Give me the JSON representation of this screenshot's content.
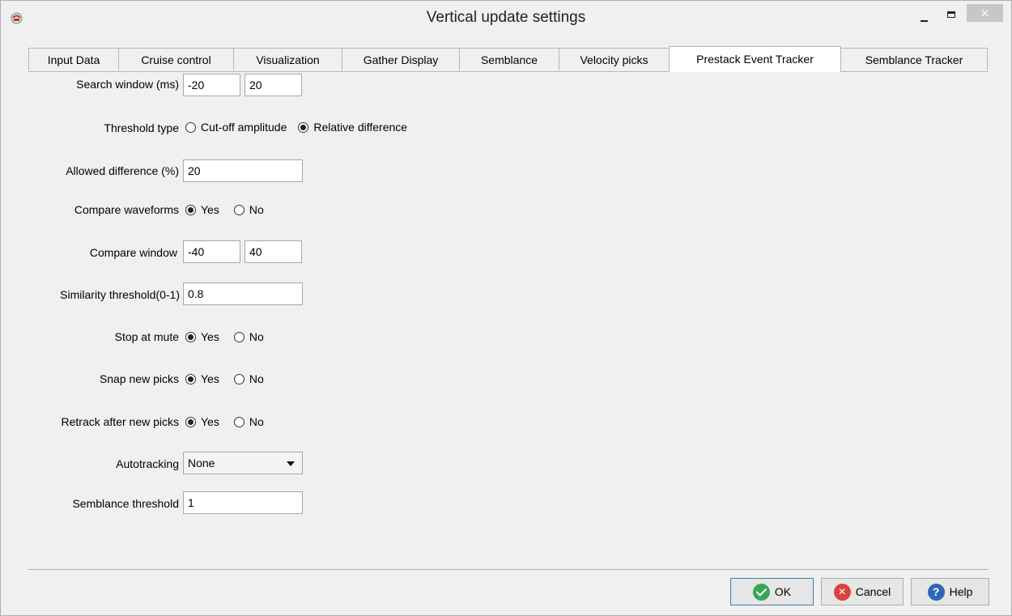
{
  "window": {
    "title": "Vertical update settings",
    "close_glyph": "×"
  },
  "tabs": [
    {
      "label": "Input Data"
    },
    {
      "label": "Cruise control"
    },
    {
      "label": "Visualization"
    },
    {
      "label": "Gather Display"
    },
    {
      "label": "Semblance"
    },
    {
      "label": "Velocity picks"
    },
    {
      "label": "Prestack Event Tracker",
      "active": true
    },
    {
      "label": "Semblance Tracker"
    }
  ],
  "form": {
    "search_window": {
      "label": "Search window (ms)",
      "min": "-20",
      "max": "20"
    },
    "threshold_type": {
      "label": "Threshold type",
      "opt1": "Cut-off amplitude",
      "opt2": "Relative difference",
      "selected": "Relative difference"
    },
    "allowed_difference": {
      "label": "Allowed difference (%)",
      "value": "20"
    },
    "compare_waveforms": {
      "label": "Compare waveforms",
      "yes": "Yes",
      "no": "No",
      "selected": "Yes"
    },
    "compare_window": {
      "label": "Compare window",
      "min": "-40",
      "max": "40"
    },
    "similarity_threshold": {
      "label": "Similarity threshold(0-1)",
      "value": "0.8"
    },
    "stop_at_mute": {
      "label": "Stop at mute",
      "yes": "Yes",
      "no": "No",
      "selected": "Yes"
    },
    "snap_new_picks": {
      "label": "Snap new picks",
      "yes": "Yes",
      "no": "No",
      "selected": "Yes"
    },
    "retrack_after_new_picks": {
      "label": "Retrack after new picks",
      "yes": "Yes",
      "no": "No",
      "selected": "Yes"
    },
    "autotracking": {
      "label": "Autotracking",
      "value": "None"
    },
    "semblance_threshold": {
      "label": "Semblance threshold",
      "value": "1"
    }
  },
  "buttons": {
    "ok": "OK",
    "cancel": "Cancel",
    "help": "Help",
    "help_glyph": "?",
    "cancel_glyph": "✕"
  },
  "colors": {
    "ok_icon": "#3aa655",
    "cancel_icon": "#d9433b",
    "help_icon": "#2f67b8",
    "active_tab": "#ffffff"
  }
}
